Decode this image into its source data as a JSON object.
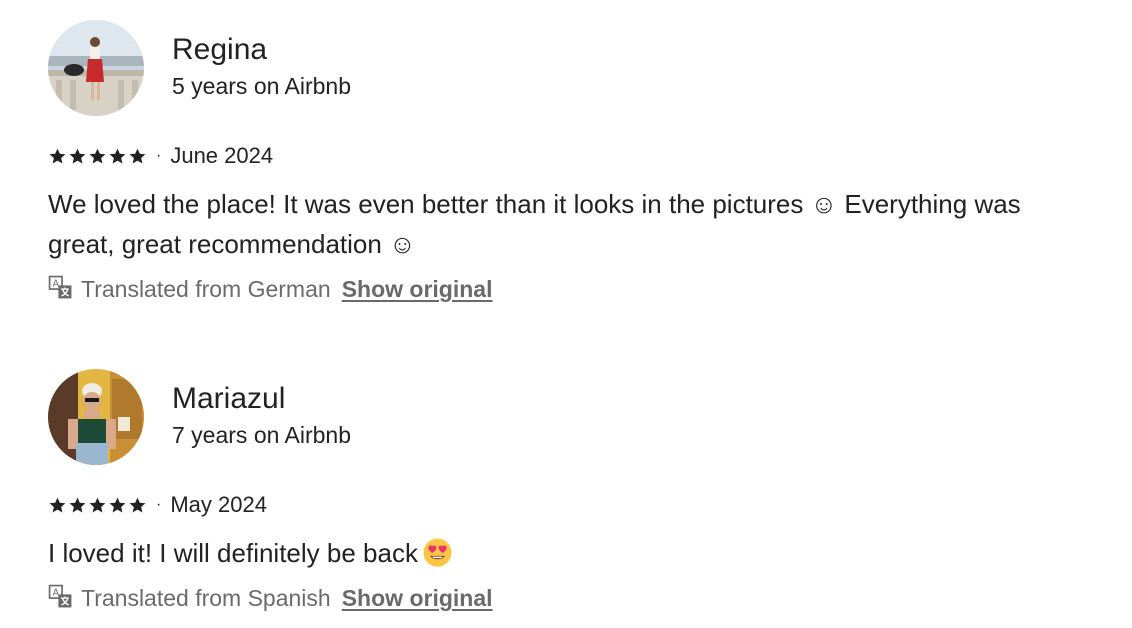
{
  "reviews": [
    {
      "name": "Regina",
      "tenure": "5 years on Airbnb",
      "rating": 5,
      "date": "June 2024",
      "text": "We loved the place! It was even better than it looks in the pictures ☺ Everything was great, great recommendation ☺",
      "translation_note": "Translated from German",
      "show_original_label": "Show original",
      "avatar_icon": "profile-photo-woman-red-skirt"
    },
    {
      "name": "Mariazul",
      "tenure": "7 years on Airbnb",
      "rating": 5,
      "date": "May 2024",
      "text": "I loved it! I will definitely be back",
      "text_emoji": "smiling-face-with-heart-eyes",
      "translation_note": "Translated from Spanish",
      "show_original_label": "Show original",
      "avatar_icon": "profile-photo-woman-sunglasses"
    }
  ],
  "colors": {
    "primary_text": "#222222",
    "secondary_text": "#6a6a6a",
    "star": "#222222"
  },
  "icons": {
    "star": "star-icon",
    "translate": "translate-icon"
  }
}
